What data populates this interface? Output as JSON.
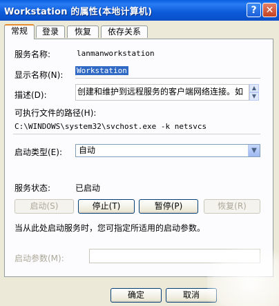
{
  "window": {
    "title": "Workstation 的属性(本地计算机)",
    "help_label": "?",
    "close_label": "✕"
  },
  "tabs": [
    {
      "label": "常规",
      "active": true
    },
    {
      "label": "登录",
      "active": false
    },
    {
      "label": "恢复",
      "active": false
    },
    {
      "label": "依存关系",
      "active": false
    }
  ],
  "general": {
    "service_name_label": "服务名称:",
    "service_name_value": "lanmanworkstation",
    "display_name_label": "显示名称(N):",
    "display_name_value": "Workstation",
    "description_label": "描述(D):",
    "description_value": "创建和维护到远程服务的客户端网络连接。如",
    "exe_path_label": "可执行文件的路径(H):",
    "exe_path_value": "C:\\WINDOWS\\system32\\svchost.exe -k netsvcs",
    "startup_type_label": "启动类型(E):",
    "startup_type_value": "自动",
    "service_status_label": "服务状态:",
    "service_status_value": "已启动",
    "buttons": {
      "start": "启动(S)",
      "stop": "停止(T)",
      "pause": "暂停(P)",
      "resume": "恢复(R)"
    },
    "hint": "当从此处启动服务时，您可指定所适用的启动参数。",
    "start_params_label": "启动参数(M):",
    "start_params_value": ""
  },
  "footer": {
    "ok": "确定",
    "cancel": "取消"
  },
  "icons": {
    "spin_up": "▲",
    "spin_down": "▼",
    "dropdown": "▼"
  }
}
